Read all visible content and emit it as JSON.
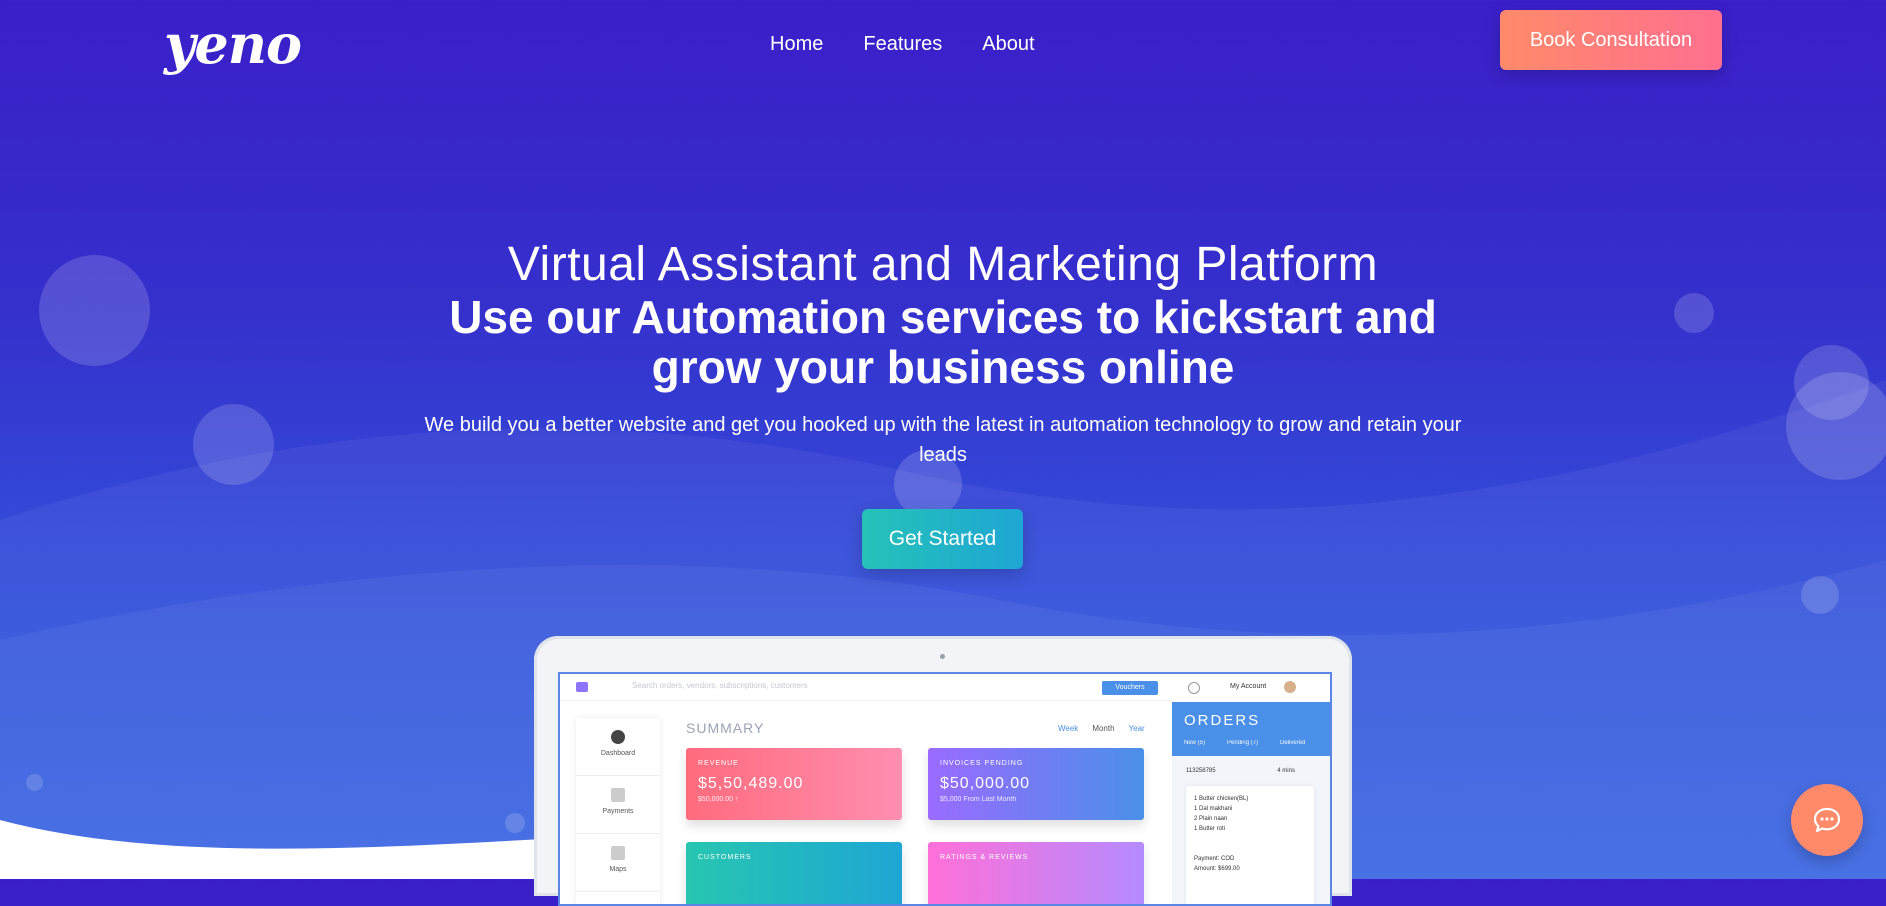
{
  "brand": {
    "logo_text": "yeno"
  },
  "nav": {
    "items": [
      "Home",
      "Features",
      "About"
    ]
  },
  "header": {
    "cta_label": "Book Consultation"
  },
  "hero": {
    "heading_light": "Virtual Assistant and Marketing Platform",
    "heading_bold": "Use our Automation services to kickstart and grow your business online",
    "subtext": "We build you a better website and get you hooked up with the latest in automation technology to grow and retain your leads",
    "cta_label": "Get Started"
  },
  "mockup": {
    "search_placeholder": "Search orders, vendors, subscriptions, customers",
    "vouchers_label": "Vouchers",
    "account_label": "My Account",
    "sidebar": [
      "Dashboard",
      "Payments",
      "Maps"
    ],
    "summary_title": "SUMMARY",
    "periods": [
      "Week",
      "Month",
      "Year"
    ],
    "cards": [
      {
        "title": "REVENUE",
        "value": "$5,50,489.00",
        "sub": "$50,000.00 ↑"
      },
      {
        "title": "INVOICES PENDING",
        "value": "$50,000.00",
        "sub": "$5,000 From Last Month"
      },
      {
        "title": "CUSTOMERS",
        "value": "",
        "sub": ""
      },
      {
        "title": "RATINGS & REVIEWS",
        "value": "",
        "sub": ""
      }
    ],
    "orders": {
      "title": "ORDERS",
      "tabs": [
        "New (5)",
        "Pending (7)",
        "Delivered"
      ],
      "order_id": "113258785",
      "time": "4 mins",
      "items": [
        "1 Butter chicken(BL)",
        "1 Dal makhani",
        "2 Plain naan",
        "1 Butter roti"
      ],
      "payment_label": "Payment:",
      "payment_value": "COD",
      "amount_label": "Amount:",
      "amount_value": "$699.00"
    }
  },
  "colors": {
    "accent": "#ff7a7a",
    "cta": "#26c2b8",
    "bg_top": "#3a1fc9",
    "bg_bottom": "#3562e2"
  },
  "icons": {
    "chat": "chat-bubble-icon"
  }
}
